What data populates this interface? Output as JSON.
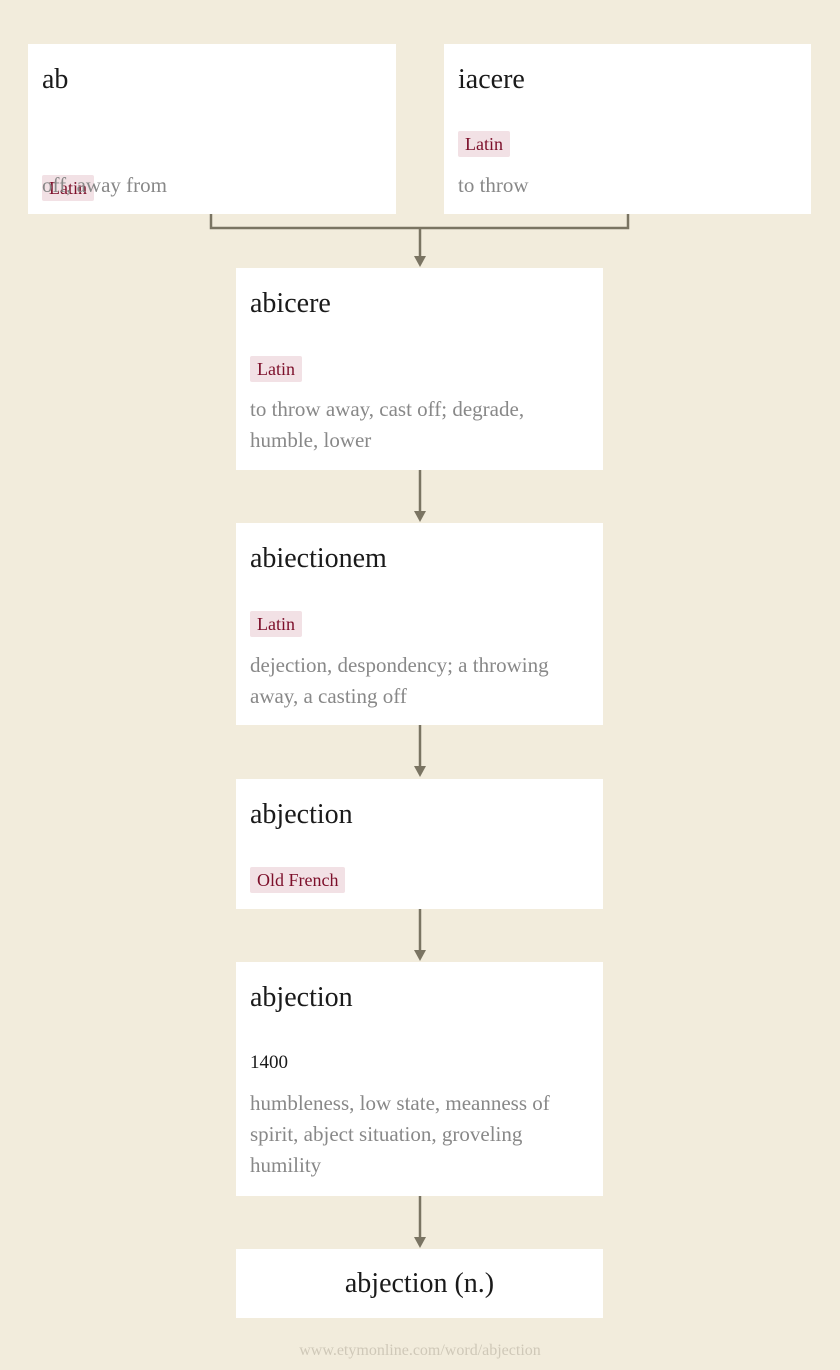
{
  "nodes": [
    {
      "word": "ab",
      "language": "Latin",
      "gloss": "off, away from"
    },
    {
      "word": "iacere",
      "language": "Latin",
      "gloss": "to throw"
    },
    {
      "word": "abicere",
      "language": "Latin",
      "gloss": "to throw away, cast off; degrade, humble, lower"
    },
    {
      "word": "abiectionem",
      "language": "Latin",
      "gloss": "dejection, despondency; a throwing away, a casting off"
    },
    {
      "word": "abjection",
      "language": "Old French"
    },
    {
      "word": "abjection",
      "year": "1400",
      "gloss": "humbleness, low state, meanness of spirit, abject situation, groveling humility"
    },
    {
      "word": "abjection (n.)"
    }
  ],
  "colors": {
    "background": "#f2ecdc",
    "card": "#ffffff",
    "language_badge_bg": "#f2e1e5",
    "language_badge_text": "#7c0f2a",
    "connector": "#7a7462"
  },
  "footer": "www.etymonline.com/word/abjection"
}
